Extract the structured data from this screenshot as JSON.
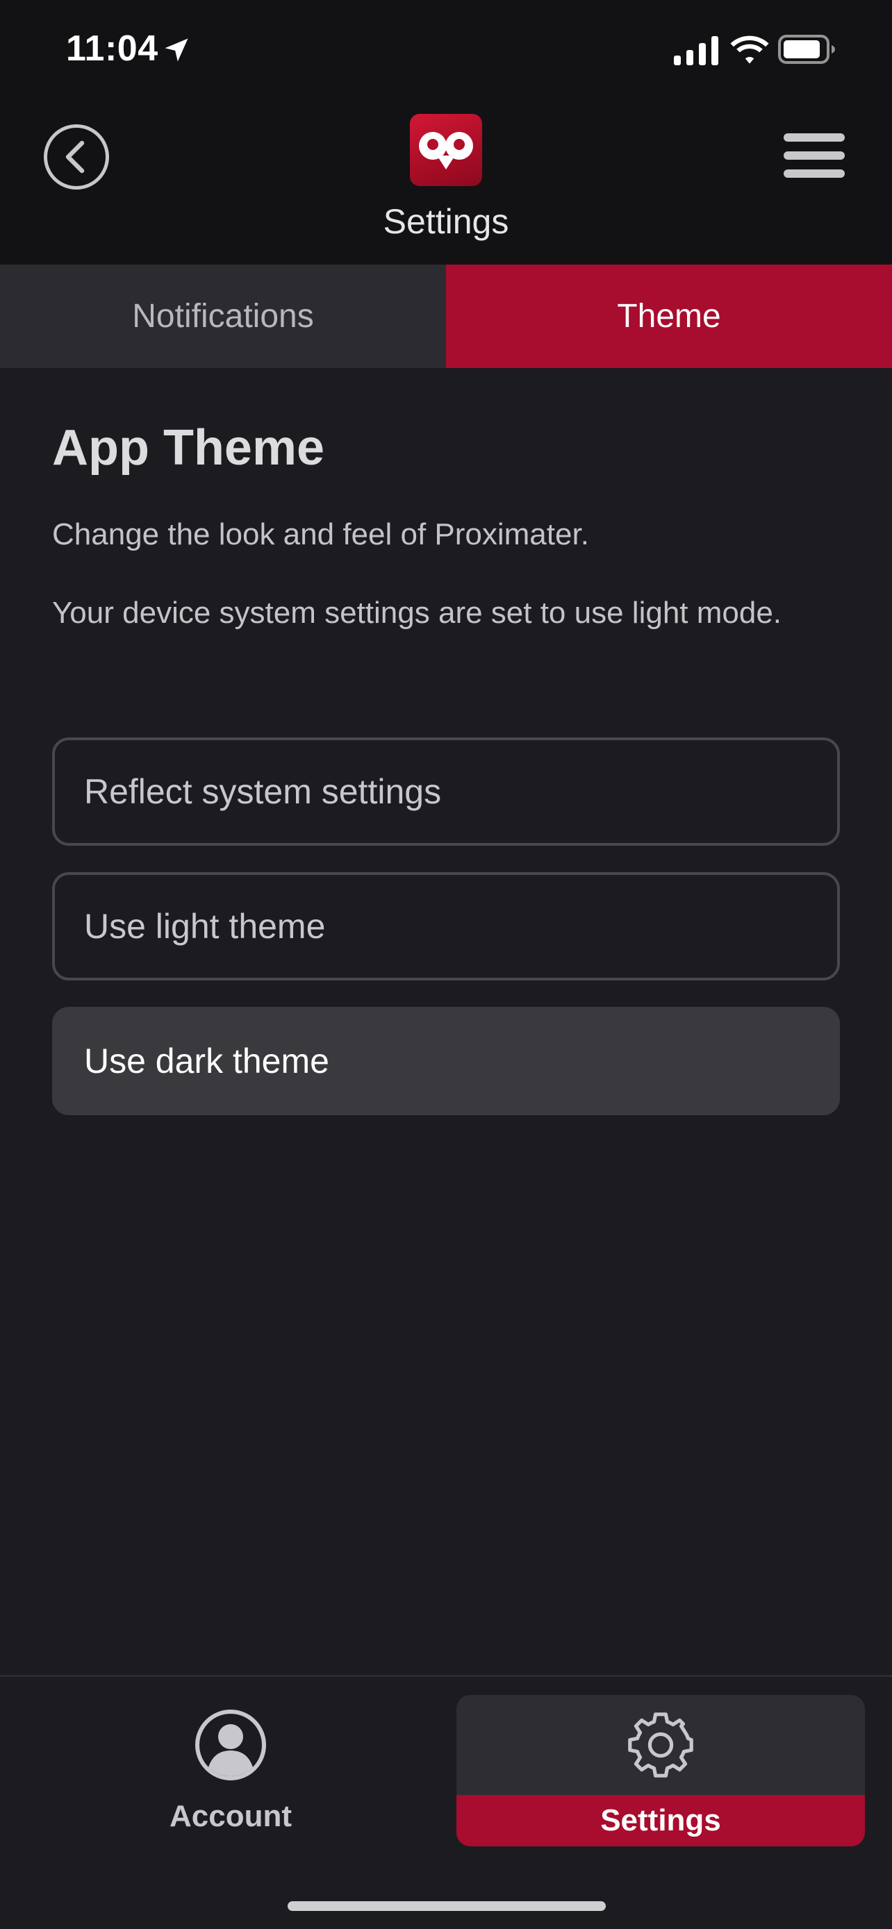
{
  "status_bar": {
    "time": "11:04"
  },
  "header": {
    "title": "Settings"
  },
  "tabs": [
    {
      "label": "Notifications",
      "active": false
    },
    {
      "label": "Theme",
      "active": true
    }
  ],
  "content": {
    "title": "App Theme",
    "description": "Change the look and feel of Proximater.",
    "system_note": "Your device system settings are set to use light mode.",
    "options": [
      {
        "label": "Reflect system settings",
        "selected": false
      },
      {
        "label": "Use light theme",
        "selected": false
      },
      {
        "label": "Use dark theme",
        "selected": true
      }
    ]
  },
  "bottom_nav": {
    "items": [
      {
        "label": "Account",
        "icon": "user-icon",
        "active": false
      },
      {
        "label": "Settings",
        "icon": "gear-icon",
        "active": true
      }
    ]
  },
  "colors": {
    "accent": "#a80c2e",
    "background": "#1c1c20",
    "header_background": "#121214"
  }
}
